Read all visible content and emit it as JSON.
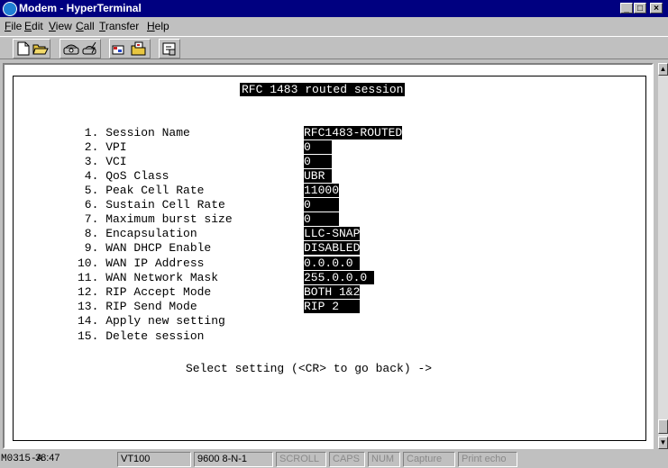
{
  "window": {
    "title": "Modem - HyperTerminal"
  },
  "menu": [
    "File",
    "Edit",
    "View",
    "Call",
    "Transfer",
    "Help"
  ],
  "toolbar": {
    "icons": [
      "new-icon",
      "open-icon",
      "connect-icon",
      "disconnect-icon",
      "send-icon",
      "receive-icon",
      "properties-icon"
    ]
  },
  "terminal": {
    "title": "RFC 1483 routed session",
    "rows": [
      {
        "label": " 1. Session Name",
        "value": "RFC1483-ROUTED"
      },
      {
        "label": " 2. VPI",
        "value": "0   "
      },
      {
        "label": " 3. VCI",
        "value": "0   "
      },
      {
        "label": " 4. QoS Class",
        "value": "UBR "
      },
      {
        "label": " 5. Peak Cell Rate",
        "value": "11000"
      },
      {
        "label": " 6. Sustain Cell Rate",
        "value": "0    "
      },
      {
        "label": " 7. Maximum burst size",
        "value": "0    "
      },
      {
        "label": " 8. Encapsulation",
        "value": "LLC-SNAP"
      },
      {
        "label": " 9. WAN DHCP Enable",
        "value": "DISABLED"
      },
      {
        "label": "10. WAN IP Address",
        "value": "0.0.0.0 "
      },
      {
        "label": "11. WAN Network Mask",
        "value": "255.0.0.0 "
      },
      {
        "label": "12. RIP Accept Mode",
        "value": "BOTH 1&2"
      },
      {
        "label": "13. RIP Send Mode",
        "value": "RIP 2   "
      },
      {
        "label": "14. Apply new setting",
        "value": ""
      },
      {
        "label": "15. Delete session",
        "value": ""
      }
    ],
    "prompt": "Select setting (<CR> to go back) ->"
  },
  "status": {
    "device": "M0315-A",
    "time": "38:47",
    "emulation": "VT100",
    "settings": "9600 8-N-1",
    "scroll": "SCROLL",
    "caps": "CAPS",
    "num": "NUM",
    "capture": "Capture",
    "print_echo": "Print echo"
  }
}
